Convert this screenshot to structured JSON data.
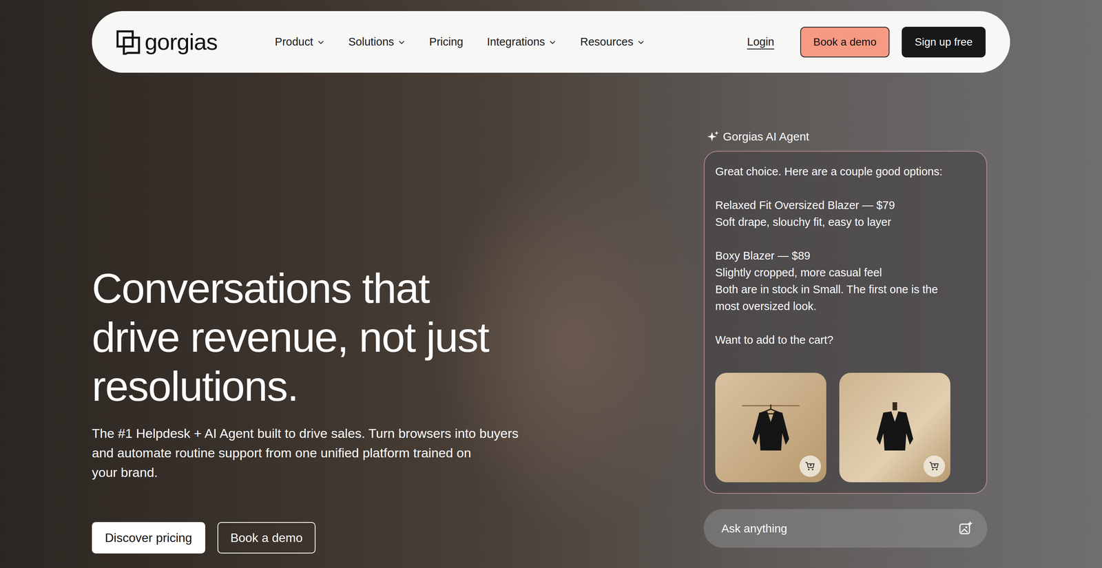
{
  "nav": {
    "logo": "gorgias",
    "items": [
      {
        "label": "Product",
        "dropdown": true
      },
      {
        "label": "Solutions",
        "dropdown": true
      },
      {
        "label": "Pricing",
        "dropdown": false
      },
      {
        "label": "Integrations",
        "dropdown": true
      },
      {
        "label": "Resources",
        "dropdown": true
      }
    ],
    "login": "Login",
    "buttons": [
      {
        "label": "Book a demo",
        "kind": "accent"
      },
      {
        "label": "Sign up free",
        "kind": "dark"
      }
    ]
  },
  "hero": {
    "title_lines": [
      "Conversations that",
      "drive revenue, not just",
      "resolutions."
    ],
    "subtitle_lines": [
      "The #1 Helpdesk + AI Agent built to drive sales. Turn browsers into buyers",
      "and automate routine support from one unified platform trained on",
      "your brand."
    ],
    "buttons": [
      {
        "label": "Discover pricing",
        "kind": "solid"
      },
      {
        "label": "Book a demo",
        "kind": "outline"
      }
    ]
  },
  "agent": {
    "label": "Gorgias AI Agent",
    "paragraphs": [
      [
        "Great choice. Here are a couple good options:"
      ],
      [
        "Relaxed Fit Oversized Blazer — $79",
        "Soft drape, slouchy fit, easy to layer"
      ],
      [
        "Boxy Blazer — $89",
        "Slightly cropped, more casual feel",
        "Both are in stock in Small. The first one is the",
        "most oversized look."
      ],
      [
        "Want to add to the cart?"
      ]
    ],
    "products": [
      {
        "kind": "hanger"
      },
      {
        "kind": "mannequin"
      }
    ],
    "input": {
      "placeholder": "Ask anything"
    }
  }
}
